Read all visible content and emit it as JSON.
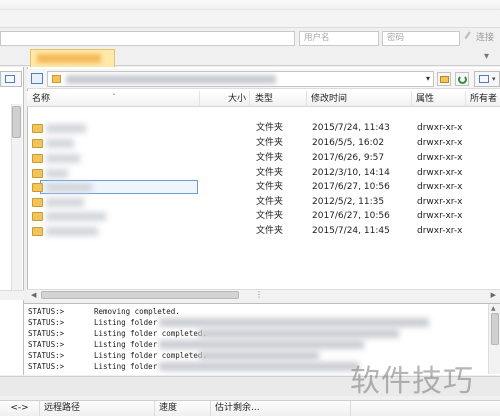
{
  "top": {
    "username_placeholder": "用户名",
    "password_placeholder": "密码",
    "connect_label": "连接"
  },
  "remote": {
    "columns": {
      "name": "名称",
      "size": "大小",
      "type": "类型",
      "modified": "修改时间",
      "perms": "属性",
      "owner": "所有者"
    },
    "rows": [
      {
        "type": "文件夹",
        "date": "2015/7/24, 11:43",
        "perm": "drwxr-xr-x"
      },
      {
        "type": "文件夹",
        "date": "2016/5/5, 16:02",
        "perm": "drwxr-xr-x"
      },
      {
        "type": "文件夹",
        "date": "2017/6/26, 9:57",
        "perm": "drwxr-xr-x"
      },
      {
        "type": "文件夹",
        "date": "2012/3/10, 14:14",
        "perm": "drwxr-xr-x"
      },
      {
        "type": "文件夹",
        "date": "2017/6/27, 10:56",
        "perm": "drwxr-xr-x"
      },
      {
        "type": "文件夹",
        "date": "2012/5/2, 11:35",
        "perm": "drwxr-xr-x"
      },
      {
        "type": "文件夹",
        "date": "2017/6/27, 10:56",
        "perm": "drwxr-xr-x"
      },
      {
        "type": "文件夹",
        "date": "2015/7/24, 11:45",
        "perm": "drwxr-xr-x"
      }
    ]
  },
  "log": {
    "lines": [
      {
        "label": "STATUS:>",
        "text": "Removing completed."
      },
      {
        "label": "STATUS:>",
        "text": "Listing folder"
      },
      {
        "label": "STATUS:>",
        "text": "Listing folder completed."
      },
      {
        "label": "STATUS:>",
        "text": "Listing folder"
      },
      {
        "label": "STATUS:>",
        "text": "Listing folder completed."
      },
      {
        "label": "STATUS:>",
        "text": "Listing folder"
      }
    ]
  },
  "queue": {
    "arrows": "<->",
    "remote_path": "远程路径",
    "speed": "速度",
    "eta": "估计剩余..."
  },
  "watermark": "软件技巧"
}
